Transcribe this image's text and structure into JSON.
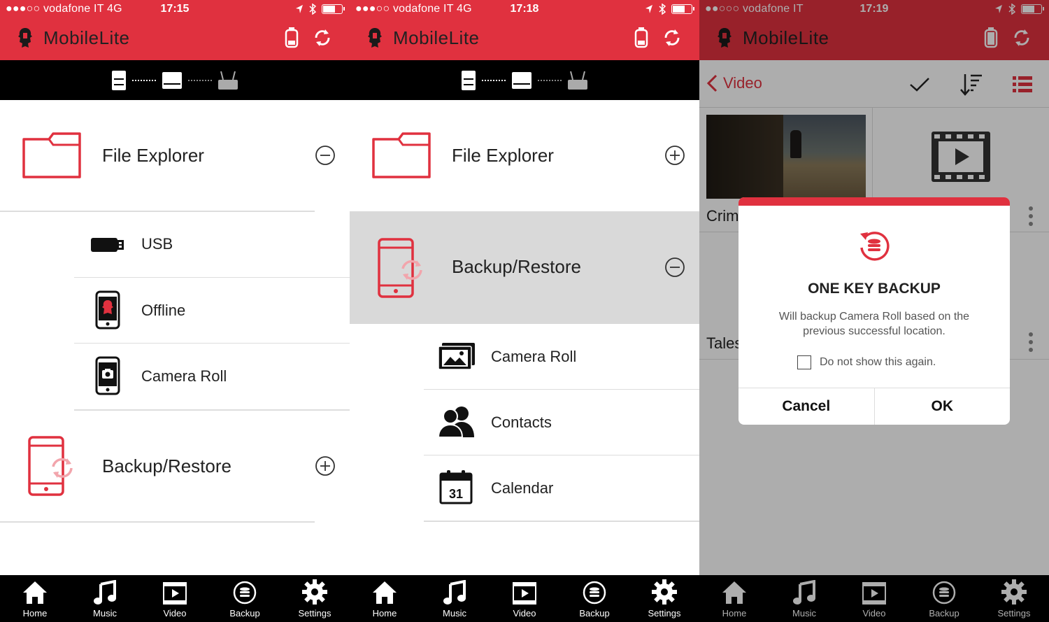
{
  "screens": [
    {
      "status": {
        "carrier": "●●●○○ vodafone IT  4G",
        "time": "17:15"
      },
      "app_name": "MobileLite",
      "file_explorer": {
        "label": "File Explorer",
        "toggle": "collapse"
      },
      "file_explorer_items": [
        {
          "label": "USB",
          "icon": "usb-drive-icon"
        },
        {
          "label": "Offline",
          "icon": "phone-icon"
        },
        {
          "label": "Camera Roll",
          "icon": "camera-phone-icon"
        }
      ],
      "backup_restore": {
        "label": "Backup/Restore",
        "toggle": "expand"
      }
    },
    {
      "status": {
        "carrier": "●●●○○ vodafone IT  4G",
        "time": "17:18"
      },
      "app_name": "MobileLite",
      "file_explorer": {
        "label": "File Explorer",
        "toggle": "expand"
      },
      "backup_restore": {
        "label": "Backup/Restore",
        "toggle": "collapse"
      },
      "backup_items": [
        {
          "label": "Camera Roll",
          "icon": "photos-icon"
        },
        {
          "label": "Contacts",
          "icon": "contacts-icon"
        },
        {
          "label": "Calendar",
          "icon": "calendar-icon",
          "day": "31"
        }
      ]
    },
    {
      "status": {
        "carrier": "●●○○○ vodafone IT",
        "time": "17:19"
      },
      "app_name": "MobileLite",
      "nav": {
        "back_label": "Video"
      },
      "videos": [
        {
          "title": "Crim"
        },
        {
          "title": "Tales"
        }
      ],
      "dialog": {
        "title": "ONE KEY BACKUP",
        "message": "Will backup Camera Roll based on the previous successful location.",
        "checkbox_label": "Do not show this again.",
        "cancel_label": "Cancel",
        "ok_label": "OK"
      }
    }
  ],
  "tabs": [
    {
      "label": "Home",
      "icon": "home-icon"
    },
    {
      "label": "Music",
      "icon": "music-icon"
    },
    {
      "label": "Video",
      "icon": "video-icon"
    },
    {
      "label": "Backup",
      "icon": "backup-icon"
    },
    {
      "label": "Settings",
      "icon": "gear-icon"
    }
  ],
  "colors": {
    "accent": "#e0313f",
    "dark": "#000000",
    "selected_row": "#d9d9d9",
    "text": "#222222"
  }
}
